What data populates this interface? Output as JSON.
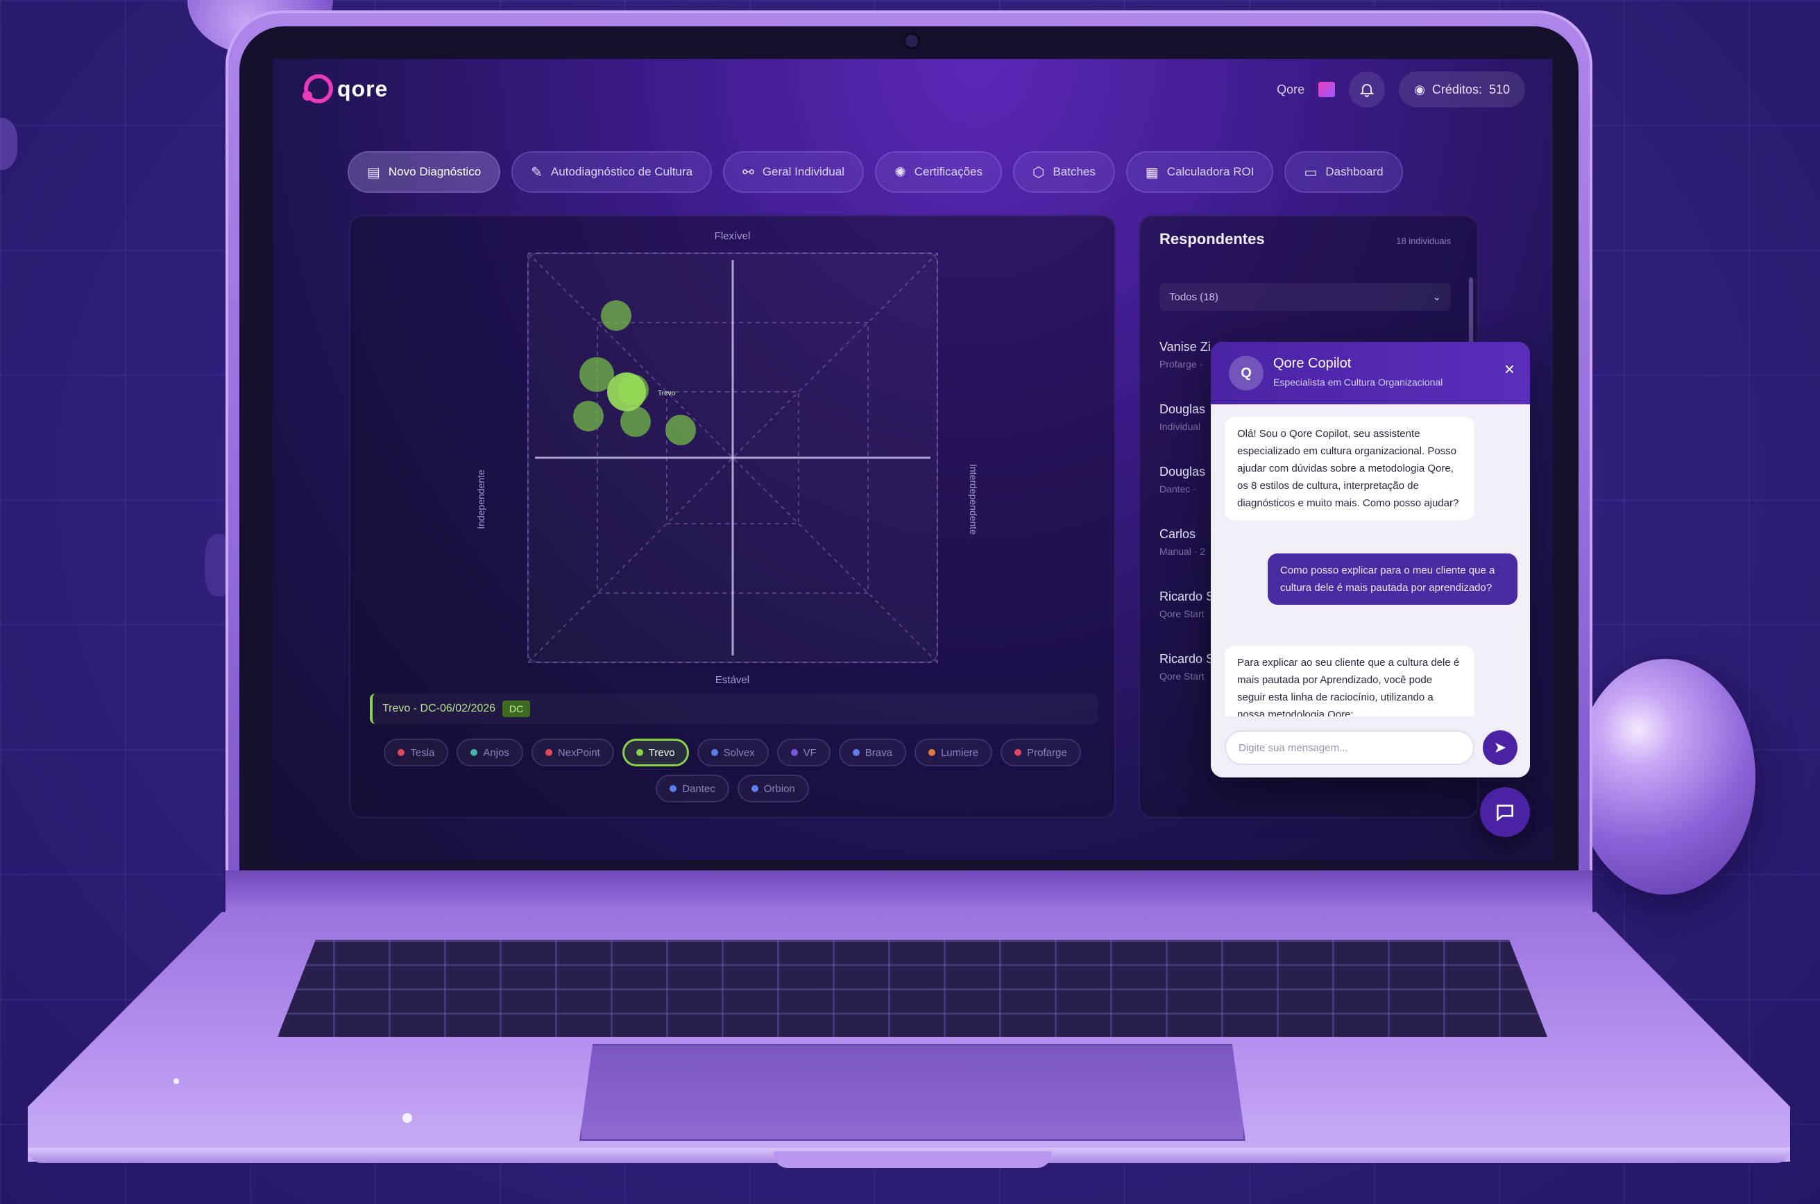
{
  "app": {
    "logo_text": "qore",
    "user_name": "Qore",
    "credits_label": "Créditos:",
    "credits_value": "510",
    "accent": "#e83bb7",
    "brand": "#4a23a5"
  },
  "tabs": [
    {
      "label": "Novo Diagnóstico",
      "icon": "document-icon",
      "active": true
    },
    {
      "label": "Autodiagnóstico de Cultura",
      "icon": "pencil-icon",
      "active": false
    },
    {
      "label": "Geral Individual",
      "icon": "link-icon",
      "active": false
    },
    {
      "label": "Certificações",
      "icon": "certificate-icon",
      "active": false
    },
    {
      "label": "Batches",
      "icon": "package-icon",
      "active": false
    },
    {
      "label": "Calculadora ROI",
      "icon": "calculator-icon",
      "active": false
    },
    {
      "label": "Dashboard",
      "icon": "monitor-icon",
      "active": false
    }
  ],
  "chart": {
    "axis_top": "Flexível",
    "axis_bottom": "Estável",
    "axis_left": "Independente",
    "axis_right": "Interdependente",
    "point_label": "Trevo",
    "filter_text": "Trevo - DC-06/02/2026",
    "filter_badge": "DC",
    "point_color": "#8ad34a"
  },
  "chips": [
    {
      "label": "Tesla",
      "color": "#e0485c",
      "active": false
    },
    {
      "label": "Anjos",
      "color": "#3fb6a8",
      "active": false
    },
    {
      "label": "NexPoint",
      "color": "#e0485c",
      "active": false
    },
    {
      "label": "Trevo",
      "color": "#8ad34a",
      "active": true
    },
    {
      "label": "Solvex",
      "color": "#5b7ee8",
      "active": false
    },
    {
      "label": "VF",
      "color": "#7a55e0",
      "active": false
    },
    {
      "label": "Brava",
      "color": "#5b7ee8",
      "active": false
    },
    {
      "label": "Lumiere",
      "color": "#e07a3c",
      "active": false
    },
    {
      "label": "Profarge",
      "color": "#e0485c",
      "active": false
    },
    {
      "label": "Dantec",
      "color": "#5b7ee8",
      "active": false
    },
    {
      "label": "Orbion",
      "color": "#5b7ee8",
      "active": false
    }
  ],
  "respondents": {
    "title": "Respondentes",
    "count": "18 individuais",
    "filter_value": "Todos (18)",
    "items": [
      {
        "name": "Vanise Zi",
        "sub": "Profarge ·"
      },
      {
        "name": "Douglas",
        "sub": "Individual"
      },
      {
        "name": "Douglas",
        "sub": "Dantec ·"
      },
      {
        "name": "Carlos",
        "sub": "Manual · 2"
      },
      {
        "name": "Ricardo S",
        "sub": "Qore Start"
      },
      {
        "name": "Ricardo S",
        "sub": "Qore Start"
      }
    ]
  },
  "copilot": {
    "avatar": "Q",
    "title": "Qore Copilot",
    "subtitle": "Especialista em Cultura Organizacional",
    "messages": [
      {
        "role": "bot",
        "text": "Olá! Sou o Qore Copilot, seu assistente especializado em cultura organizacional. Posso ajudar com dúvidas sobre a metodologia Qore, os 8 estilos de cultura, interpretação de diagnósticos e muito mais. Como posso ajudar?"
      },
      {
        "role": "user",
        "text": "Como posso explicar para o meu cliente que a cultura dele é mais pautada por aprendizado?"
      },
      {
        "role": "bot",
        "text": "Para explicar ao seu cliente que a cultura dele é mais pautada por Aprendizado, você pode seguir esta linha de raciocínio, utilizando a nossa metodologia Qore:"
      }
    ],
    "input_placeholder": "Digite sua mensagem..."
  }
}
